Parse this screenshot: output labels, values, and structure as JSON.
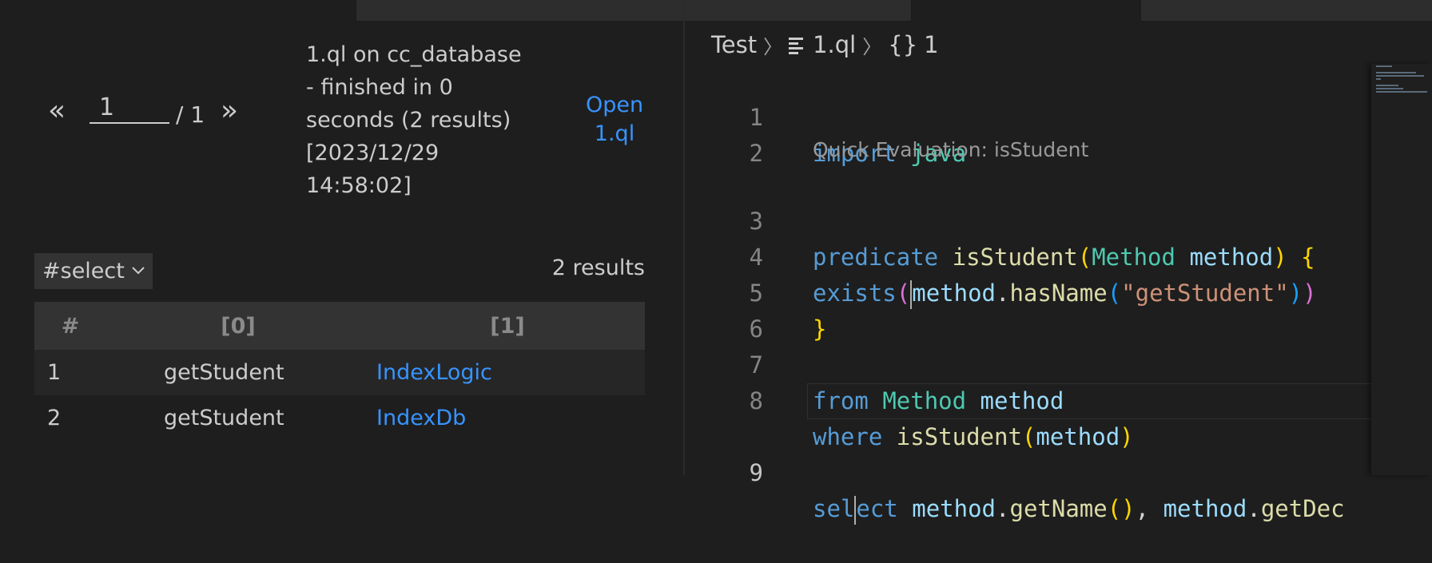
{
  "pager": {
    "prev": "«",
    "next": "»",
    "page": "1",
    "total": "/ 1"
  },
  "query_info": {
    "line1": "1.ql on cc_database",
    "line2": "- finished in 0",
    "line3": "seconds (2 results)",
    "line4": "[2023/12/29",
    "line5": "14:58:02]"
  },
  "open_link": {
    "line1": "Open",
    "line2": "1.ql"
  },
  "result_set": {
    "label": "#select",
    "count": "2 results"
  },
  "table": {
    "headers": [
      "#",
      "[0]",
      "[1]"
    ],
    "rows": [
      {
        "idx": "1",
        "c0": "getStudent",
        "c1": "IndexLogic"
      },
      {
        "idx": "2",
        "c0": "getStudent",
        "c1": "IndexDb"
      }
    ]
  },
  "breadcrumb": {
    "folder": "Test",
    "file": "1.ql",
    "symbol": "1",
    "sep": "〉",
    "braces": "{}"
  },
  "editor": {
    "codelens": "Quick Evaluation: isStudent",
    "line_numbers": [
      "1",
      "2",
      "3",
      "4",
      "5",
      "6",
      "7",
      "8",
      "9"
    ],
    "tokens": {
      "import": "import",
      "java": "java",
      "predicate": "predicate",
      "isStudent": "isStudent",
      "lp": "(",
      "Method": "Method",
      "method": "method",
      "rp": ")",
      "lbrace": "{",
      "rbrace": "}",
      "exists": "exists",
      "dot": ".",
      "hasName": "hasName",
      "str": "\"getStudent\"",
      "from": "from",
      "where": "where",
      "sel": "sel",
      "ect": "ect",
      "getName": "getName",
      "comma": ",",
      "getDec": "getDec"
    }
  },
  "colors": {
    "background": "#1e1e1e",
    "link": "#3794ff",
    "keyword": "#569cd6",
    "type": "#4ec9b0",
    "function": "#dcdcaa",
    "variable": "#9cdcfe",
    "string": "#ce9178"
  }
}
